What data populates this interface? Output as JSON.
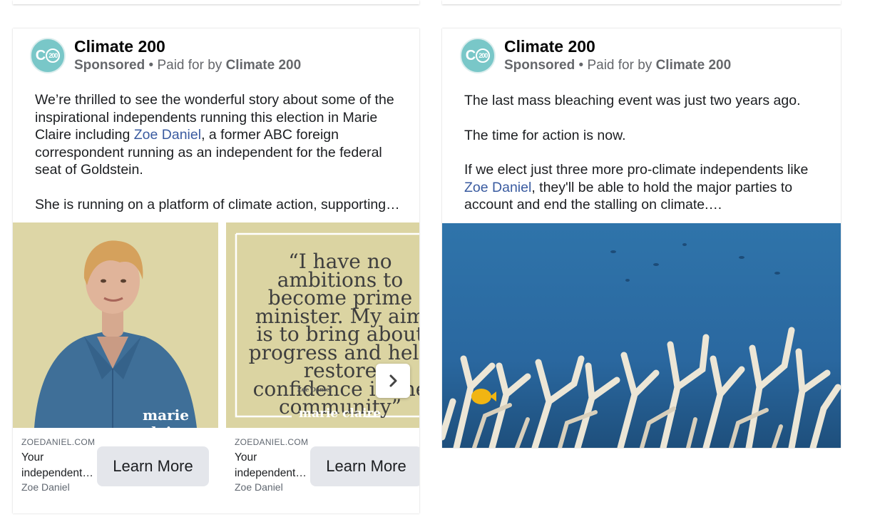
{
  "colors": {
    "accent_link": "#3a5ba0",
    "avatar_teal": "#79c7c8",
    "button_bg": "#e4e6eb",
    "carousel_bg": "#dcd5a4",
    "ocean_blue": "#2d6fa3"
  },
  "icons": {
    "next": "chevron-right-icon"
  },
  "ad_left": {
    "page_name": "Climate 200",
    "avatar_text": "C",
    "avatar_text_small": "200",
    "sponsored": "Sponsored",
    "separator": " • ",
    "paid_prefix": "Paid for by ",
    "paid_by": "Climate 200",
    "para1_before_link": "We’re thrilled to see the wonderful story about some of the inspirational independents running this election in Marie Claire including ",
    "para1_link": "Zoe Daniel",
    "para1_after_link": ", a former ABC foreign correspondent running as an independent for the federal seat of Goldstein.",
    "para2": "She is running on a platform of climate action, supporting…",
    "carousel": [
      {
        "domain": "ZOEDANIEL.COM.AU",
        "headline": "Your independent…",
        "sub": "Zoe Daniel",
        "cta": "Learn More",
        "watermark": "marie claire"
      },
      {
        "domain": "ZOEDANIEL.COM.AU",
        "headline": "Your independent…",
        "sub": "Zoe Daniel",
        "cta": "Learn More",
        "quote": "“I have no ambitions to become prime minister. My aim is to bring about progress and help restore confidence in the community”",
        "quote_author": "Zoe Daniel",
        "watermark": "marie claire"
      }
    ]
  },
  "ad_right": {
    "page_name": "Climate 200",
    "avatar_text": "C",
    "avatar_text_small": "200",
    "sponsored": "Sponsored",
    "separator": " • ",
    "paid_prefix": "Paid for by ",
    "paid_by": "Climate 200",
    "para1": "The last mass bleaching event was just two years ago.",
    "para2": "The time for action is now.",
    "para3_before_link": "If we elect just three more pro-climate independents like ",
    "para3_link": "Zoe Daniel",
    "para3_after_link": ", they'll be able to hold the major parties to account and end the stalling on climate.…"
  }
}
